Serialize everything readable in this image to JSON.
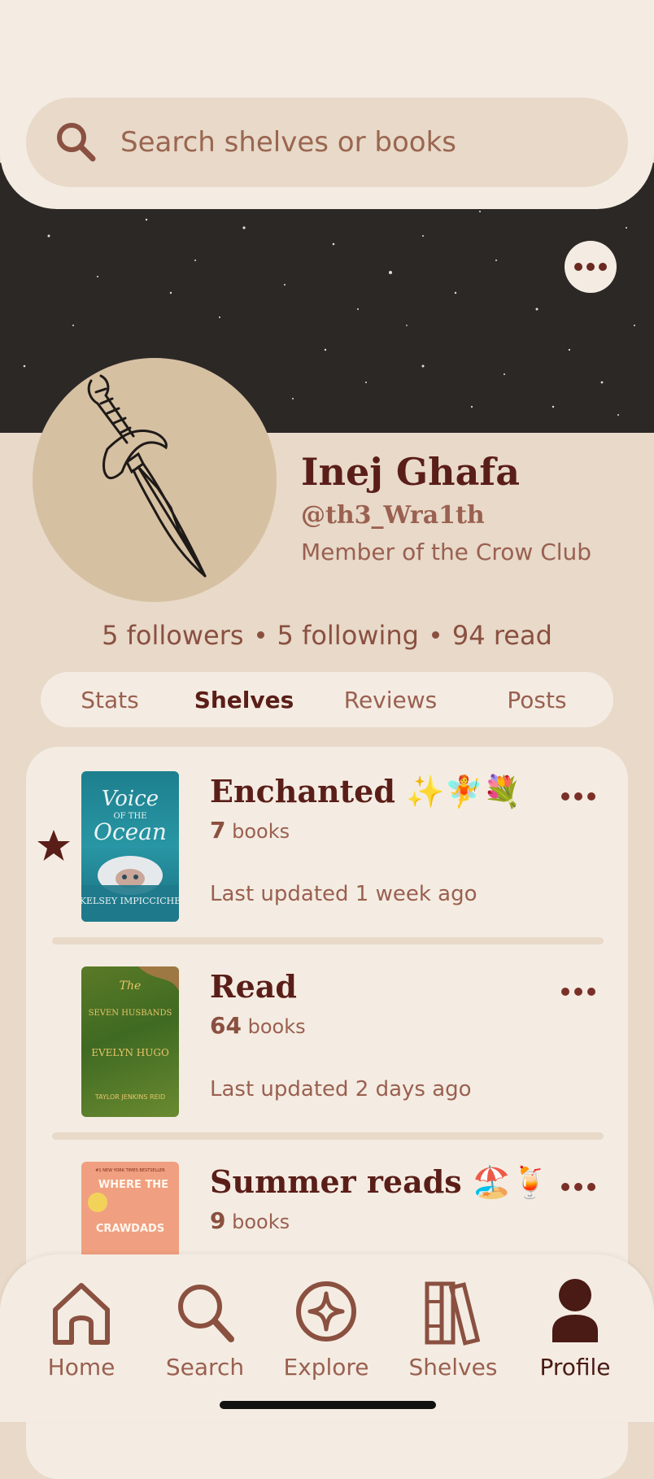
{
  "search": {
    "placeholder": "Search shelves or books"
  },
  "profile": {
    "name": "Inej Ghafa",
    "handle": "@th3_Wra1th",
    "bio": "Member of the Crow Club",
    "followers_count": "5",
    "followers_label": "followers",
    "following_count": "5",
    "following_label": "following",
    "read_count": "94",
    "read_label": "read"
  },
  "tabs": [
    {
      "label": "Stats",
      "active": false
    },
    {
      "label": "Shelves",
      "active": true
    },
    {
      "label": "Reviews",
      "active": false
    },
    {
      "label": "Posts",
      "active": false
    }
  ],
  "shelves": [
    {
      "title": "Enchanted ✨🧚💐",
      "count": "7",
      "count_label": "books",
      "updated": "Last updated 1 week ago",
      "starred": true,
      "cover": {
        "top": "Voice",
        "mid": "OF THE",
        "main": "Ocean",
        "author": "KELSEY IMPICCICHE"
      }
    },
    {
      "title": "Read",
      "count": "64",
      "count_label": "books",
      "updated": "Last updated 2 days ago",
      "starred": false,
      "cover": {
        "top": "The",
        "mid": "SEVEN HUSBANDS",
        "main": "EVELYN HUGO",
        "author": "TAYLOR JENKINS REID"
      }
    },
    {
      "title": "Summer reads 🏖️🍹",
      "count": "9",
      "count_label": "books",
      "updated": "",
      "starred": false,
      "cover": {
        "top": "#1 NEW YORK TIMES BESTSELLER",
        "mid": "WHERE THE",
        "main": "CRAWDADS",
        "author": ""
      }
    }
  ],
  "nav": [
    {
      "label": "Home",
      "icon": "home-icon",
      "active": false
    },
    {
      "label": "Search",
      "icon": "search-icon",
      "active": false
    },
    {
      "label": "Explore",
      "icon": "compass-icon",
      "active": false
    },
    {
      "label": "Shelves",
      "icon": "books-icon",
      "active": false
    },
    {
      "label": "Profile",
      "icon": "person-icon",
      "active": true
    }
  ],
  "colors": {
    "accent": "#5a1e18",
    "text": "#8a5040",
    "background": "#e8d9c9",
    "surface": "#f4ece2",
    "banner": "#2c2826"
  }
}
